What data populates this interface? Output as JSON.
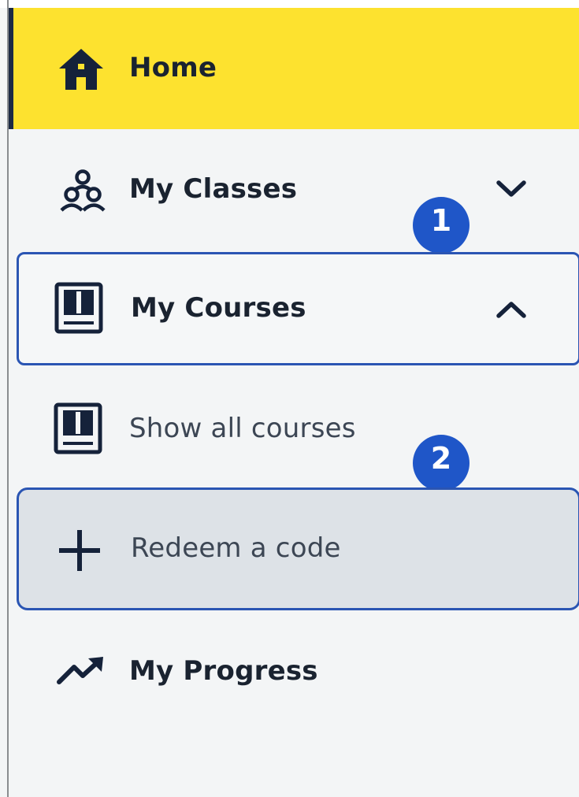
{
  "nav": {
    "home": {
      "label": "Home",
      "icon": "home-icon"
    },
    "classes": {
      "label": "My Classes",
      "icon": "group-users-icon",
      "chevron": "chevron-down-icon"
    },
    "courses": {
      "label": "My Courses",
      "icon": "book-icon",
      "chevron": "chevron-up-icon"
    },
    "show_all": {
      "label": "Show all courses",
      "icon": "book-icon"
    },
    "redeem": {
      "label": "Redeem a code",
      "icon": "plus-icon"
    },
    "progress": {
      "label": "My Progress",
      "icon": "trend-up-icon"
    }
  },
  "markers": [
    {
      "number": "1"
    },
    {
      "number": "2"
    }
  ],
  "colors": {
    "active_background": "#fde22f",
    "sidebar_background": "#f3f5f6",
    "text": "#1a2330",
    "highlight_border": "#2a55b3",
    "marker_fill": "#1f56c8",
    "hover_background": "#dde2e7"
  }
}
